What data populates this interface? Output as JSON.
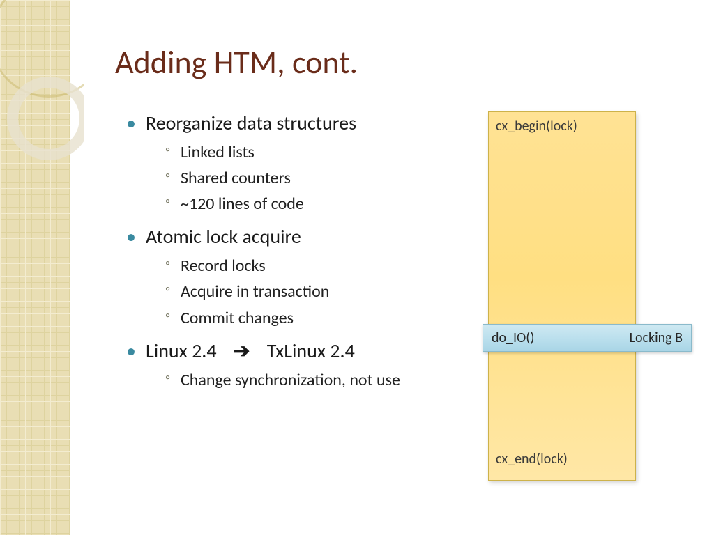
{
  "title": "Adding HTM, cont.",
  "bullets": {
    "b1": {
      "head": "Reorganize data structures",
      "sub": [
        "Linked lists",
        "Shared counters",
        "~120 lines of code"
      ]
    },
    "b2": {
      "head": "Atomic lock acquire",
      "sub": [
        "Record locks",
        "Acquire in transaction",
        "Commit changes"
      ]
    },
    "b3": {
      "head_pre": "Linux 2.4",
      "arrow": "➔",
      "head_post": "TxLinux 2.4",
      "sub": [
        "Change synchronization, not use"
      ]
    }
  },
  "box": {
    "begin": "cx_begin(lock)",
    "end": "cx_end(lock)"
  },
  "iobar": {
    "left": "do_IO()",
    "right": "Locking B"
  }
}
